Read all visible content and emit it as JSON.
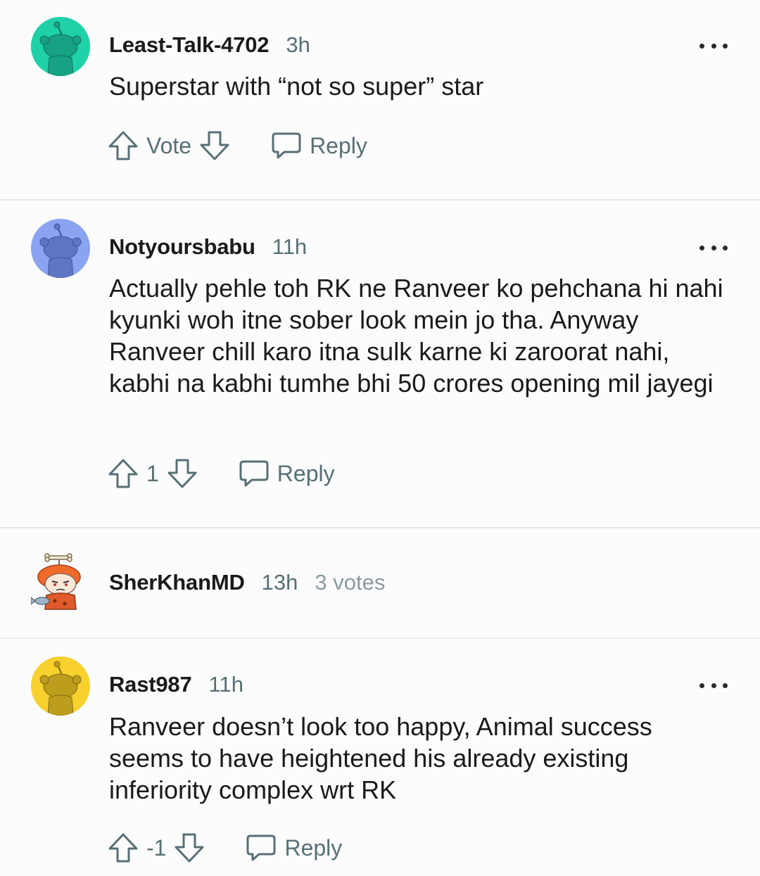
{
  "comments": [
    {
      "username": "Least-Talk-4702",
      "time": "3h",
      "body": "Superstar with “not so super” star",
      "vote_label": "Vote",
      "reply_label": "Reply",
      "avatar_color": "#1fd1a8"
    },
    {
      "username": "Notyoursbabu",
      "time": "11h",
      "body": "Actually pehle toh RK ne Ranveer ko pehchana hi nahi kyunki woh itne sober look mein jo tha. Anyway Ranveer chill karo itna sulk karne ki zaroorat nahi, kabhi na kabhi tumhe bhi 50 crores opening mil jayegi",
      "vote_label": "1",
      "reply_label": "Reply",
      "avatar_color": "#8aa4f2"
    },
    {
      "username": "SherKhanMD",
      "time": "13h",
      "votes": "3 votes"
    },
    {
      "username": "Rast987",
      "time": "11h",
      "body": "Ranveer doesn’t look too happy, Animal success seems to have heightened his already existing inferiority complex wrt RK",
      "vote_label": "-1",
      "reply_label": "Reply",
      "avatar_color": "#f8d12e"
    }
  ],
  "icons": {
    "upvote": "upvote-arrow-icon",
    "downvote": "downvote-arrow-icon",
    "reply": "speech-bubble-icon",
    "more": "more-options-icon"
  },
  "colors": {
    "text": "#1a1a1b",
    "meta": "#576f76",
    "divider": "#e5e8ea"
  }
}
